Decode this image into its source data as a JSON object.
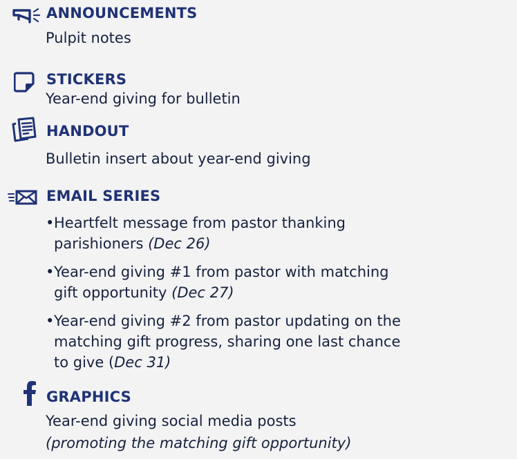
{
  "colors": {
    "heading": "#1f3275",
    "body": "#16213d",
    "background": "#f3f3f4"
  },
  "sections": {
    "announcements": {
      "icon": "megaphone-icon",
      "title": "ANNOUNCEMENTS",
      "desc": "Pulpit notes"
    },
    "stickers": {
      "icon": "sticky-note-icon",
      "title": "STICKERS",
      "desc": "Year-end giving for bulletin"
    },
    "handout": {
      "icon": "documents-icon",
      "title": "HANDOUT",
      "desc": "Bulletin insert about year-end giving"
    },
    "email_series": {
      "icon": "email-fast-icon",
      "title": "EMAIL SERIES",
      "bullet_marker": "•",
      "items": [
        {
          "line1": "Heartfelt message from pastor thanking",
          "line2_text": "parishioners ",
          "date": "(Dec 26)"
        },
        {
          "line1": "Year-end giving #1 from pastor with matching",
          "line2_text": "gift opportunity ",
          "date": "(Dec 27)"
        },
        {
          "line1": "Year-end giving #2 from pastor updating on the",
          "line2": "matching gift progress, sharing one last chance",
          "line3_text": "to give (",
          "date": "Dec 31)"
        }
      ]
    },
    "graphics": {
      "icon": "facebook-icon",
      "title": "GRAPHICS",
      "desc": "Year-end giving social media posts",
      "note": "(promoting the matching gift opportunity)"
    }
  }
}
